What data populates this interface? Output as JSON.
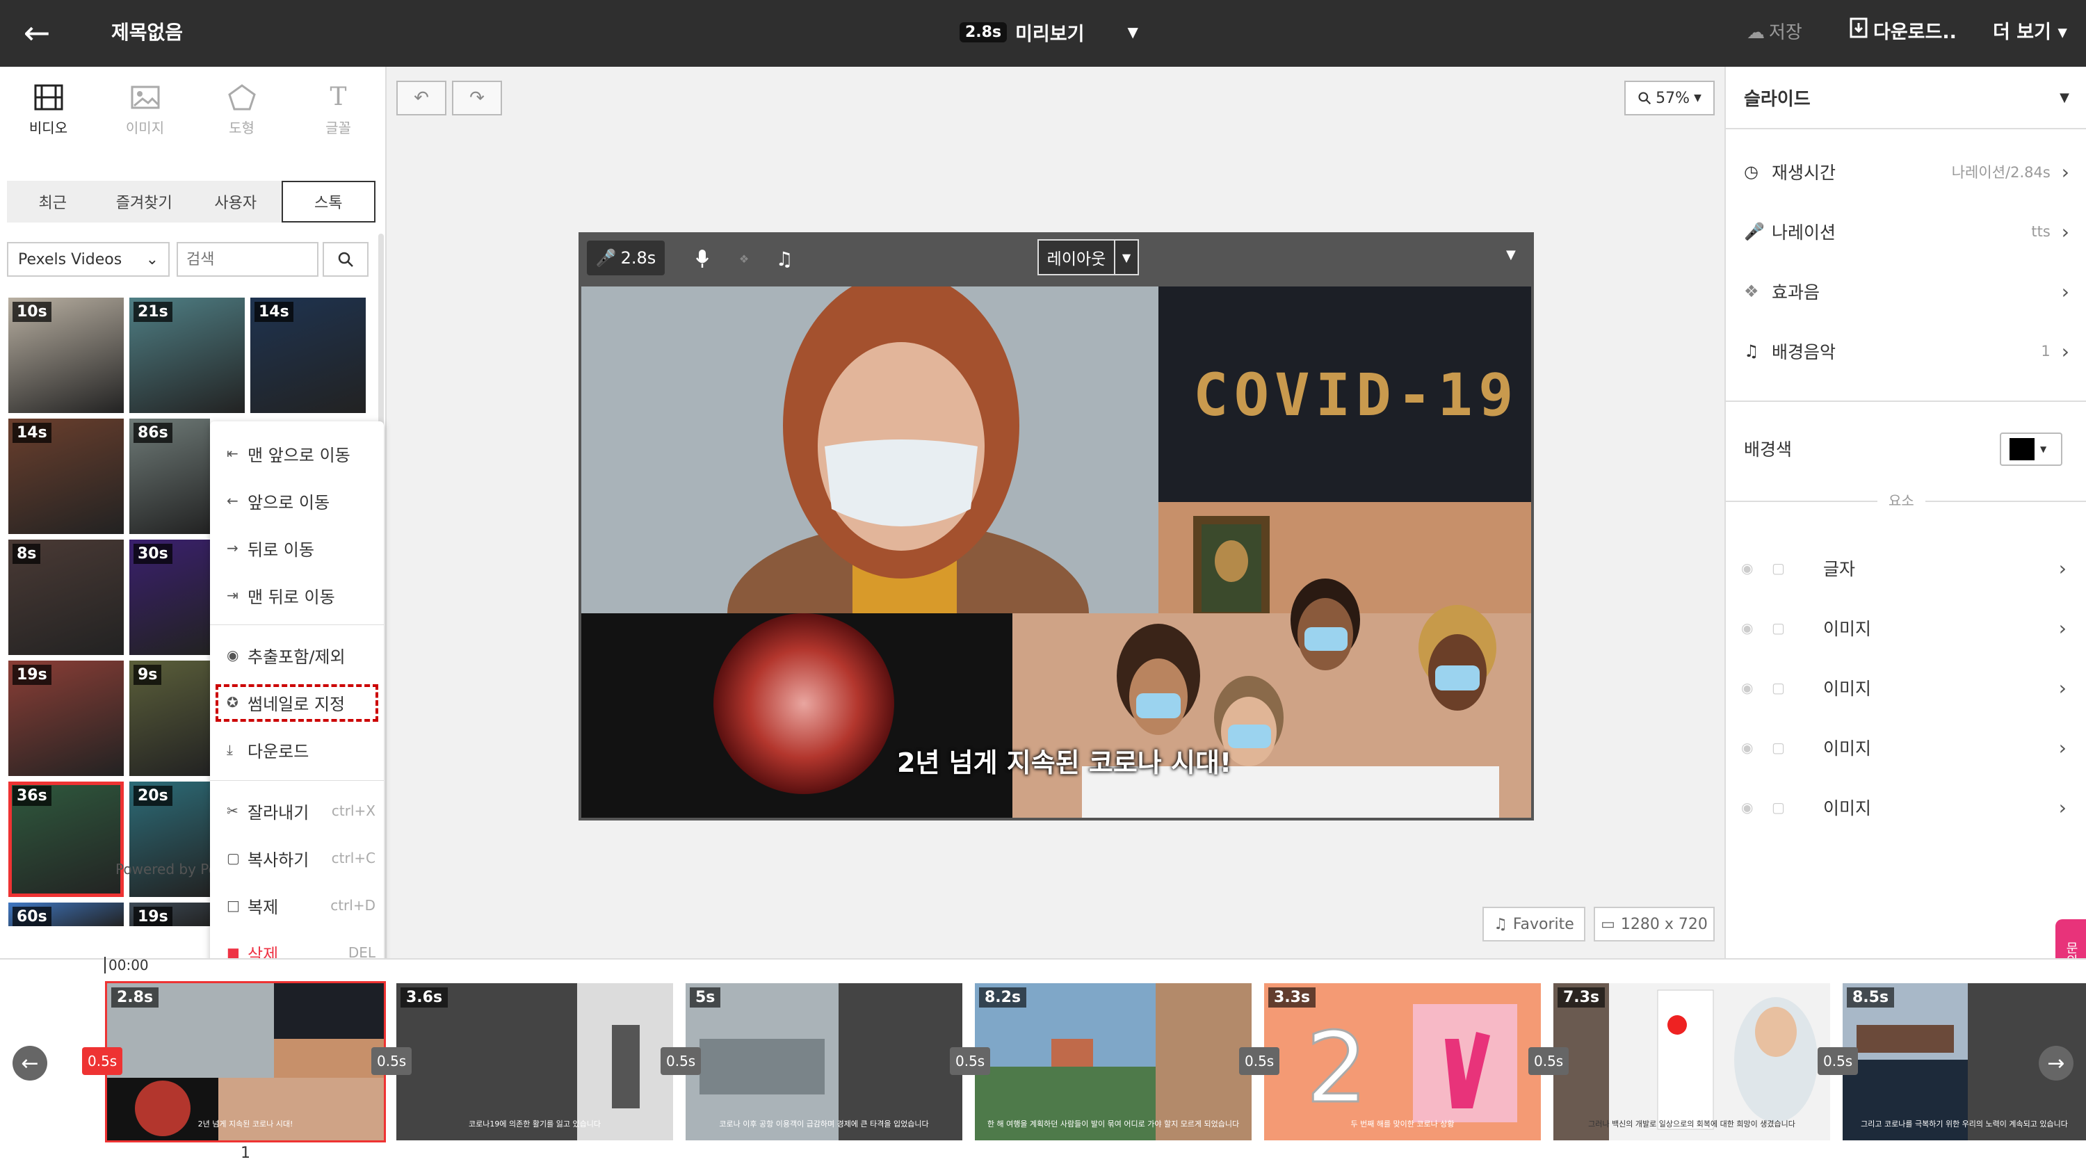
{
  "header": {
    "title": "제목없음",
    "preview_duration": "2.8s",
    "preview_label": "미리보기",
    "save_label": "저장",
    "download_label": "다운로드..",
    "more_label": "더 보기"
  },
  "tools": [
    {
      "label": "비디오",
      "icon": "film-icon"
    },
    {
      "label": "이미지",
      "icon": "image-icon"
    },
    {
      "label": "도형",
      "icon": "pentagon-icon"
    },
    {
      "label": "글꼴",
      "icon": "text-icon"
    }
  ],
  "library_tabs": [
    "최근",
    "즐겨찾기",
    "사용자",
    "스톡"
  ],
  "library": {
    "source": "Pexels Videos",
    "search_placeholder": "검색",
    "powered_by": "Powered by Pe",
    "thumbnails": [
      {
        "duration": "10s",
        "color": "#b9b0a2"
      },
      {
        "duration": "21s",
        "color": "#4f7f85"
      },
      {
        "duration": "14s",
        "color": "#1e3350"
      },
      {
        "duration": "14s",
        "color": "#6b3f2d"
      },
      {
        "duration": "86s",
        "color": "#6f7b78"
      },
      {
        "duration": "8s",
        "color": "#4a3a35"
      },
      {
        "duration": "30s",
        "color": "#3a1f6e"
      },
      {
        "duration": "19s",
        "color": "#8b3e36"
      },
      {
        "duration": "9s",
        "color": "#5b5f3a"
      },
      {
        "duration": "36s",
        "color": "#2f5a3e"
      },
      {
        "duration": "20s",
        "color": "#2c6c78"
      },
      {
        "duration": "60s",
        "color": "#3f77c2"
      },
      {
        "duration": "19s",
        "color": "#3d4a56"
      }
    ]
  },
  "context_menu": {
    "bring_to_front": "맨 앞으로 이동",
    "bring_forward": "앞으로 이동",
    "send_backward": "뒤로 이동",
    "send_to_back": "맨 뒤로 이동",
    "export_toggle": "추출포함/제외",
    "set_thumbnail": "썸네일로 지정",
    "download": "다운로드",
    "cut": "잘라내기",
    "cut_shortcut": "ctrl+X",
    "copy": "복사하기",
    "copy_shortcut": "ctrl+C",
    "duplicate": "복제",
    "duplicate_shortcut": "ctrl+D",
    "delete": "삭제",
    "delete_shortcut": "DEL"
  },
  "canvas": {
    "zoom": "57%",
    "narration_duration": "2.8s",
    "layout_label": "레이아웃",
    "caption": "2년 넘게 지속된 코로나 시대!",
    "covid_text": "COVID-19",
    "music_label": "Favorite",
    "resolution": "1280 x 720"
  },
  "right_panel": {
    "header": "슬라이드",
    "rows": [
      {
        "label": "재생시간",
        "value": "나레이션/2.84s",
        "icon": "clock-icon"
      },
      {
        "label": "나레이션",
        "value": "tts",
        "icon": "mic-icon"
      },
      {
        "label": "효과음",
        "value": "",
        "icon": "sound-effect-icon"
      },
      {
        "label": "배경음악",
        "value": "1",
        "icon": "music-icon"
      }
    ],
    "background_label": "배경색",
    "background_color": "#000000",
    "elements_label": "요소",
    "elements": [
      "글자",
      "이미지",
      "이미지",
      "이미지",
      "이미지"
    ],
    "side_tab": "문의"
  },
  "timeline": {
    "start_time": "00:00",
    "clips": [
      {
        "duration": "2.8s",
        "subtitle": "2년 넘게 지속된 코로나 시대!"
      },
      {
        "duration": "3.6s",
        "subtitle": "코로나19에 의존한 활기를 잃고 있습니다"
      },
      {
        "duration": "5s",
        "subtitle": "코로나 이후 공항 이용객이 급감하며 경제에 큰 타격을 입었습니다"
      },
      {
        "duration": "8.2s",
        "subtitle": "한 해 여행을 계획하던 사람들이 발이 묶여 어디로 가야 할지 모르게 되었습니다"
      },
      {
        "duration": "3.3s",
        "subtitle": "두 번째 해를 맞이한 코로나 상황"
      },
      {
        "duration": "7.3s",
        "subtitle": "그러나 백신의 개발로 일상으로의 회복에 대한 희망이 생겼습니다"
      },
      {
        "duration": "8.5s",
        "subtitle": "그리고 코로나를 극복하기 위한 우리의 노력이 계속되고 있습니다"
      }
    ],
    "transitions": [
      "0.5s",
      "0.5s",
      "0.5s",
      "0.5s",
      "0.5s",
      "0.5s",
      "0.5s"
    ],
    "selected_index": "1"
  }
}
